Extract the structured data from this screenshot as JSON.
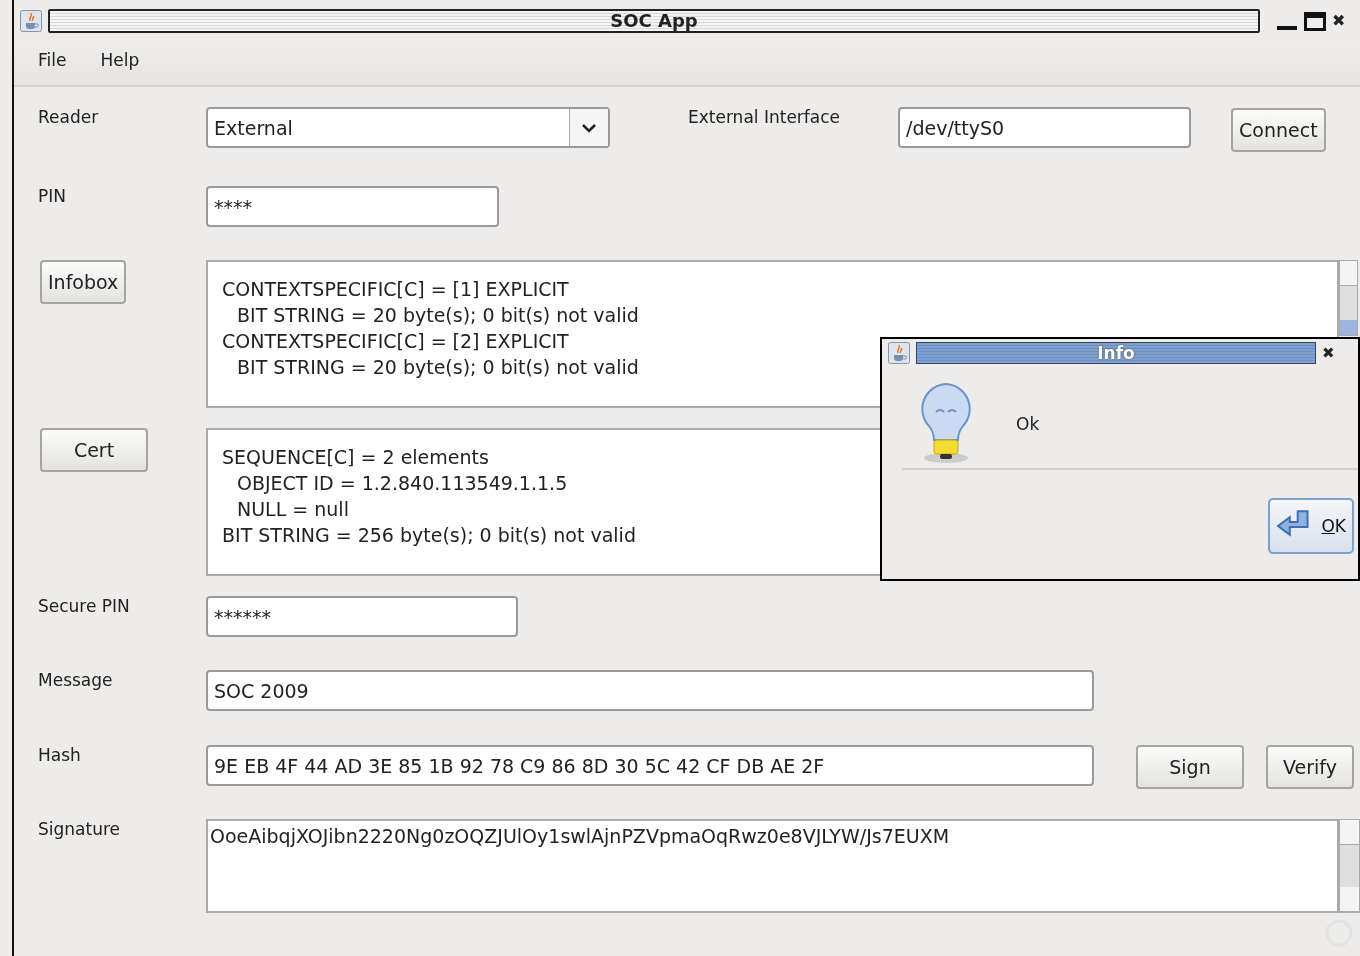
{
  "window": {
    "title": "SOC App",
    "close": "✖"
  },
  "menu": [
    {
      "label": "File"
    },
    {
      "label": "Help"
    }
  ],
  "reader": {
    "label": "Reader",
    "value": "External"
  },
  "interface": {
    "label": "External Interface",
    "value": "/dev/ttyS0",
    "button": "Connect"
  },
  "pin": {
    "label": "PIN",
    "value": "****"
  },
  "infobox": {
    "button": "Infobox",
    "lines": [
      {
        "text": "CONTEXTSPECIFIC[C] = [1] EXPLICIT",
        "children": [
          {
            "text": "BIT STRING = 20 byte(s); 0 bit(s) not valid"
          }
        ]
      },
      {
        "text": "CONTEXTSPECIFIC[C] = [2] EXPLICIT",
        "children": [
          {
            "text": "BIT STRING = 20 byte(s); 0 bit(s) not valid"
          }
        ]
      }
    ]
  },
  "cert": {
    "button": "Cert",
    "lines": [
      {
        "text": "SEQUENCE[C] = 2 elements",
        "children": [
          {
            "text": "OBJECT ID = 1.2.840.113549.1.1.5"
          },
          {
            "text": "NULL = null"
          }
        ]
      },
      {
        "text": "BIT STRING = 256 byte(s); 0 bit(s) not valid"
      }
    ]
  },
  "secure_pin": {
    "label": "Secure PIN",
    "value": "******"
  },
  "message": {
    "label": "Message",
    "value": "SOC 2009"
  },
  "hash": {
    "label": "Hash",
    "value": "9E EB 4F 44 AD 3E 85 1B 92 78 C9 86 8D 30 5C 42 CF DB AE 2F",
    "buttons": [
      "Sign",
      "Verify"
    ]
  },
  "signature": {
    "label": "Signature",
    "value": "OoeAibqjXOJibn2220Ng0zOQZJUlOy1swlAjnPZVpmaOqRwz0e8VJLYW/Js7EUXM"
  },
  "dialog": {
    "title": "Info",
    "close": "✖",
    "message": "Ok",
    "button": "OK"
  }
}
